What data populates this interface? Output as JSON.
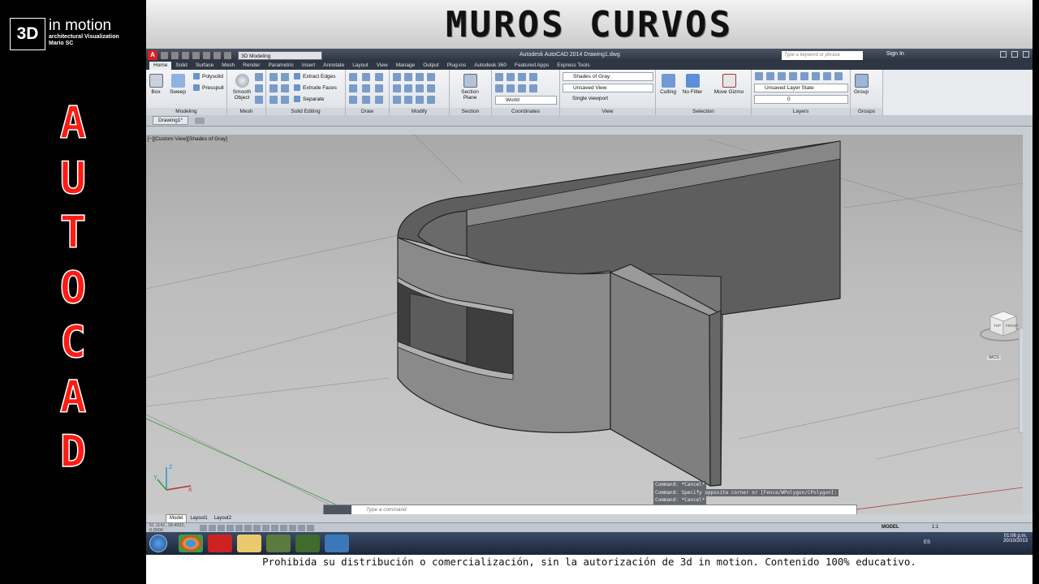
{
  "brand": {
    "box": "3D",
    "title": "in motion",
    "subtitle": "architectural Visualization",
    "author": "Mario SC"
  },
  "header": {
    "title": "MUROS CURVOS"
  },
  "vertical_text": [
    "A",
    "U",
    "T",
    "O",
    "C",
    "A",
    "D"
  ],
  "app": {
    "title": "Autodesk AutoCAD 2014     Drawing1.dwg",
    "workspace": "3D Modeling",
    "search_placeholder": "Type a keyword or phrase",
    "sign_in": "Sign In",
    "ribbon_tabs": [
      "Home",
      "Solid",
      "Surface",
      "Mesh",
      "Render",
      "Parametric",
      "Insert",
      "Annotate",
      "Layout",
      "View",
      "Manage",
      "Output",
      "Plug-ins",
      "Autodesk 360",
      "Featured Apps",
      "Express Tools"
    ],
    "panels": {
      "modeling": {
        "title": "Modeling",
        "box": "Box",
        "sweep": "Sweep",
        "polysolid": "Polysolid",
        "presspull": "Presspull"
      },
      "mesh": {
        "title": "Mesh",
        "smooth": "Smooth",
        "object": "Object"
      },
      "solid_editing": {
        "title": "Solid Editing",
        "extract": "Extract Edges",
        "extrude_faces": "Extrude Faces",
        "separate": "Separate"
      },
      "draw": {
        "title": "Draw"
      },
      "modify": {
        "title": "Modify"
      },
      "section": {
        "title": "Section",
        "plane1": "Section",
        "plane2": "Plane"
      },
      "coordinates": {
        "title": "Coordinates",
        "world": "World"
      },
      "view": {
        "title": "View",
        "visual_style": "Shades of Gray",
        "saved_view": "Unsaved View",
        "viewport": "Single viewport"
      },
      "selection": {
        "title": "Selection",
        "culling": "Culling",
        "filter": "No Filter",
        "gizmo": "Move Gizmo"
      },
      "layers": {
        "title": "Layers",
        "layer_state": "Unsaved Layer State",
        "layer": "0"
      },
      "groups": {
        "title": "Groups",
        "group": "Group"
      }
    },
    "doc_tab": "Drawing1*",
    "view_label": "[−][Custom View][Shades of Gray]",
    "viewcube": {
      "top": "TOP",
      "front": "FRONT",
      "wcs": "WCS"
    },
    "command_history": [
      "Command: *Cancel*",
      "Command: Specify opposite corner or [Fence/WPolygon/CPolygon]:",
      "Command: *Cancel*"
    ],
    "command_placeholder": "Type a command",
    "layout_tabs": [
      "Model",
      "Layout1",
      "Layout2"
    ],
    "coords": "51.1141, 18.4932, 0.0000",
    "status_model": "MODEL",
    "scale": "1:1",
    "lang": "ES",
    "time": "01:06 p.m.",
    "date": "20/10/2013"
  },
  "footer": {
    "text": "Prohibida su distribución o comercialización, sin la autorización de 3d in motion.  Contenido 100% educativo."
  }
}
